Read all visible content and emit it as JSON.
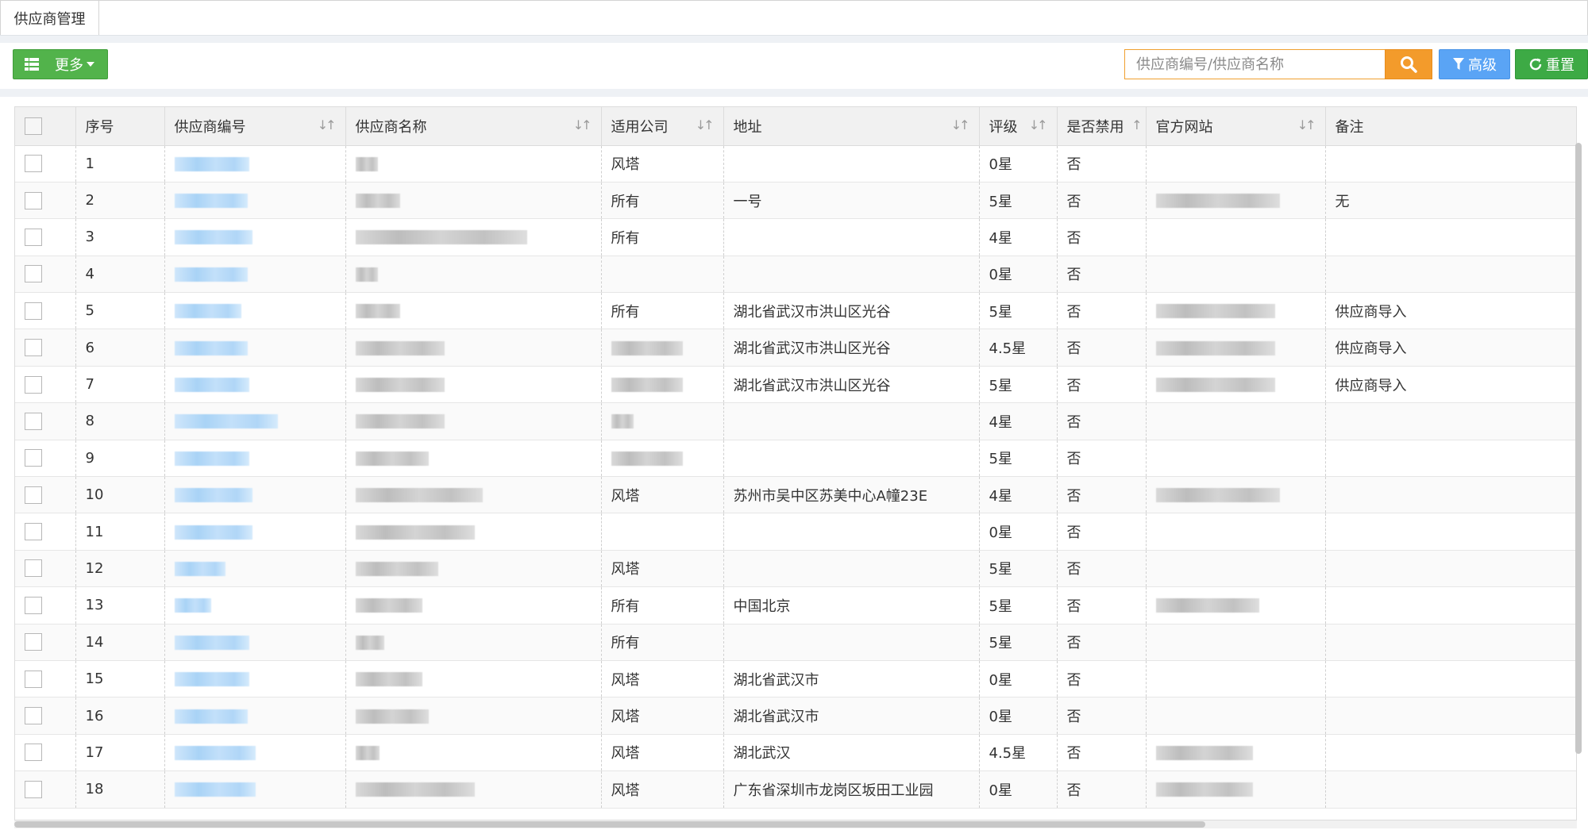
{
  "tab": {
    "label": "供应商管理"
  },
  "toolbar": {
    "more_label": "更多",
    "search_placeholder": "供应商编号/供应商名称",
    "advanced_label": "高级",
    "reset_label": "重置"
  },
  "colors": {
    "more_button": "#52b34b",
    "search_button": "#f39b2b",
    "advanced_button": "#5aa4f5",
    "reset_button": "#3daa45"
  },
  "icons": {
    "more": "grid-list-icon",
    "search": "search-icon",
    "advanced": "filter-icon",
    "reset": "refresh-icon",
    "sort": "sort-arrows-icon"
  },
  "table": {
    "columns": [
      "序号",
      "供应商编号",
      "供应商名称",
      "适用公司",
      "地址",
      "评级",
      "是否禁用",
      "官方网站",
      "备注"
    ],
    "rows": [
      {
        "no": "1",
        "company": "风塔",
        "address": "",
        "rating": "0星",
        "disabled": "否",
        "remark": ""
      },
      {
        "no": "2",
        "company": "所有",
        "address": "一号",
        "rating": "5星",
        "disabled": "否",
        "remark": "无"
      },
      {
        "no": "3",
        "company": "所有",
        "address": "",
        "rating": "4星",
        "disabled": "否",
        "remark": ""
      },
      {
        "no": "4",
        "company": "",
        "address": "",
        "rating": "0星",
        "disabled": "否",
        "remark": ""
      },
      {
        "no": "5",
        "company": "所有",
        "address": "湖北省武汉市洪山区光谷",
        "rating": "5星",
        "disabled": "否",
        "remark": "供应商导入"
      },
      {
        "no": "6",
        "company": "",
        "address": "湖北省武汉市洪山区光谷",
        "rating": "4.5星",
        "disabled": "否",
        "remark": "供应商导入"
      },
      {
        "no": "7",
        "company": "",
        "address": "湖北省武汉市洪山区光谷",
        "rating": "5星",
        "disabled": "否",
        "remark": "供应商导入"
      },
      {
        "no": "8",
        "company": "",
        "address": "",
        "rating": "4星",
        "disabled": "否",
        "remark": ""
      },
      {
        "no": "9",
        "company": "",
        "address": "",
        "rating": "5星",
        "disabled": "否",
        "remark": ""
      },
      {
        "no": "10",
        "company": "风塔",
        "address": "苏州市吴中区苏美中心A幢23E",
        "rating": "4星",
        "disabled": "否",
        "remark": ""
      },
      {
        "no": "11",
        "company": "",
        "address": "",
        "rating": "0星",
        "disabled": "否",
        "remark": ""
      },
      {
        "no": "12",
        "company": "风塔",
        "address": "",
        "rating": "5星",
        "disabled": "否",
        "remark": ""
      },
      {
        "no": "13",
        "company": "所有",
        "address": "中国北京",
        "rating": "5星",
        "disabled": "否",
        "remark": ""
      },
      {
        "no": "14",
        "company": "所有",
        "address": "",
        "rating": "5星",
        "disabled": "否",
        "remark": ""
      },
      {
        "no": "15",
        "company": "风塔",
        "address": "湖北省武汉市",
        "rating": "0星",
        "disabled": "否",
        "remark": ""
      },
      {
        "no": "16",
        "company": "风塔",
        "address": "湖北省武汉市",
        "rating": "0星",
        "disabled": "否",
        "remark": ""
      },
      {
        "no": "17",
        "company": "风塔",
        "address": "湖北武汉",
        "rating": "4.5星",
        "disabled": "否",
        "remark": ""
      },
      {
        "no": "18",
        "company": "风塔",
        "address": "广东省深圳市龙岗区坂田工业园",
        "rating": "0星",
        "disabled": "否",
        "remark": ""
      }
    ]
  }
}
